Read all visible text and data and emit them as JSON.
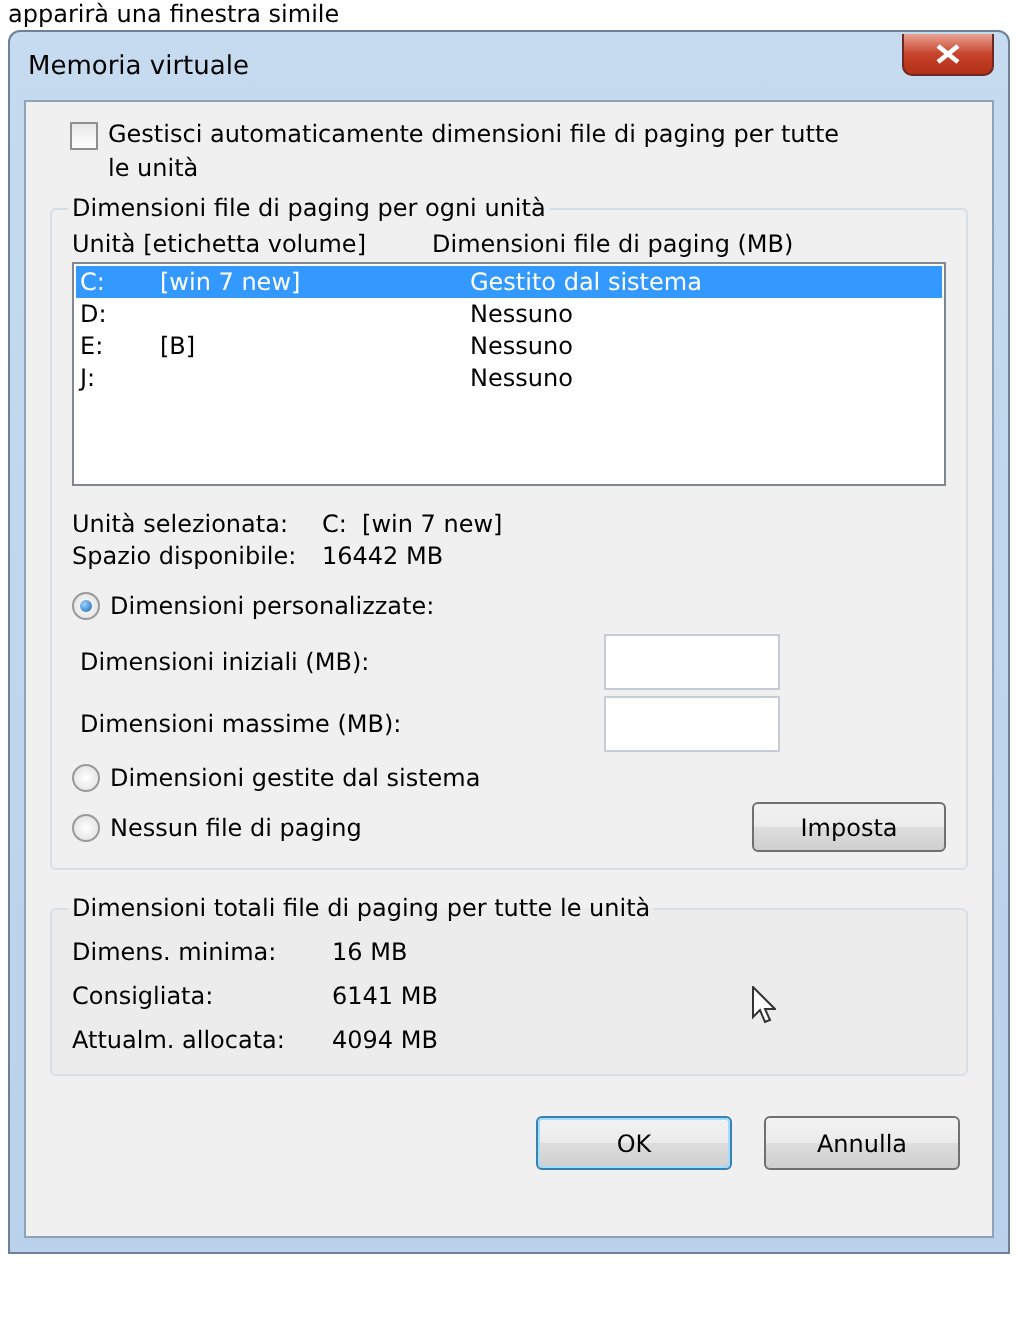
{
  "caption": "apparirà una finestra simile",
  "window": {
    "title": "Memoria virtuale"
  },
  "auto_manage": {
    "label": "Gestisci automaticamente dimensioni file di paging per tutte le unità",
    "checked": false
  },
  "drives_group": {
    "title": "Dimensioni file di paging per ogni unità",
    "columns": [
      "Unità [etichetta volume]",
      "Dimensioni file di paging (MB)"
    ],
    "rows": [
      {
        "drive": "C:",
        "label": "[win 7 new]",
        "size": "Gestito dal sistema",
        "selected": true
      },
      {
        "drive": "D:",
        "size": "Nessuno",
        "selected": false
      },
      {
        "drive": "E:",
        "label": "[B]",
        "size": "Nessuno",
        "selected": false
      },
      {
        "drive": "J:",
        "size": "Nessuno",
        "selected": false
      }
    ]
  },
  "info": [
    {
      "label": "Unità selezionata:",
      "value": "C:  [win 7 new]"
    },
    {
      "label": "Spazio disponibile:",
      "value": "16442 MB"
    }
  ],
  "size_options": [
    {
      "kind": "radio",
      "label": "Dimensioni personalizzate:",
      "selected": true
    },
    {
      "kind": "field",
      "label": "Dimensioni iniziali (MB):"
    },
    {
      "kind": "field",
      "label": "Dimensioni massime (MB):"
    },
    {
      "kind": "radio",
      "label": "Dimensioni gestite dal sistema",
      "selected": false
    },
    {
      "kind": "radio",
      "label": "Nessun file di paging",
      "selected": false
    }
  ],
  "set_button": "Imposta",
  "totals_group": {
    "title": "Dimensioni totali file di paging per tutte le unità",
    "rows": [
      {
        "label": "Dimens. minima:",
        "value": "16 MB"
      },
      {
        "label": "Consigliata:",
        "value": "6141 MB"
      },
      {
        "label": "Attualm. allocata:",
        "value": "4094 MB"
      }
    ]
  },
  "buttons": [
    {
      "label": "OK",
      "default": true
    },
    {
      "label": "Annulla",
      "default": false
    }
  ]
}
